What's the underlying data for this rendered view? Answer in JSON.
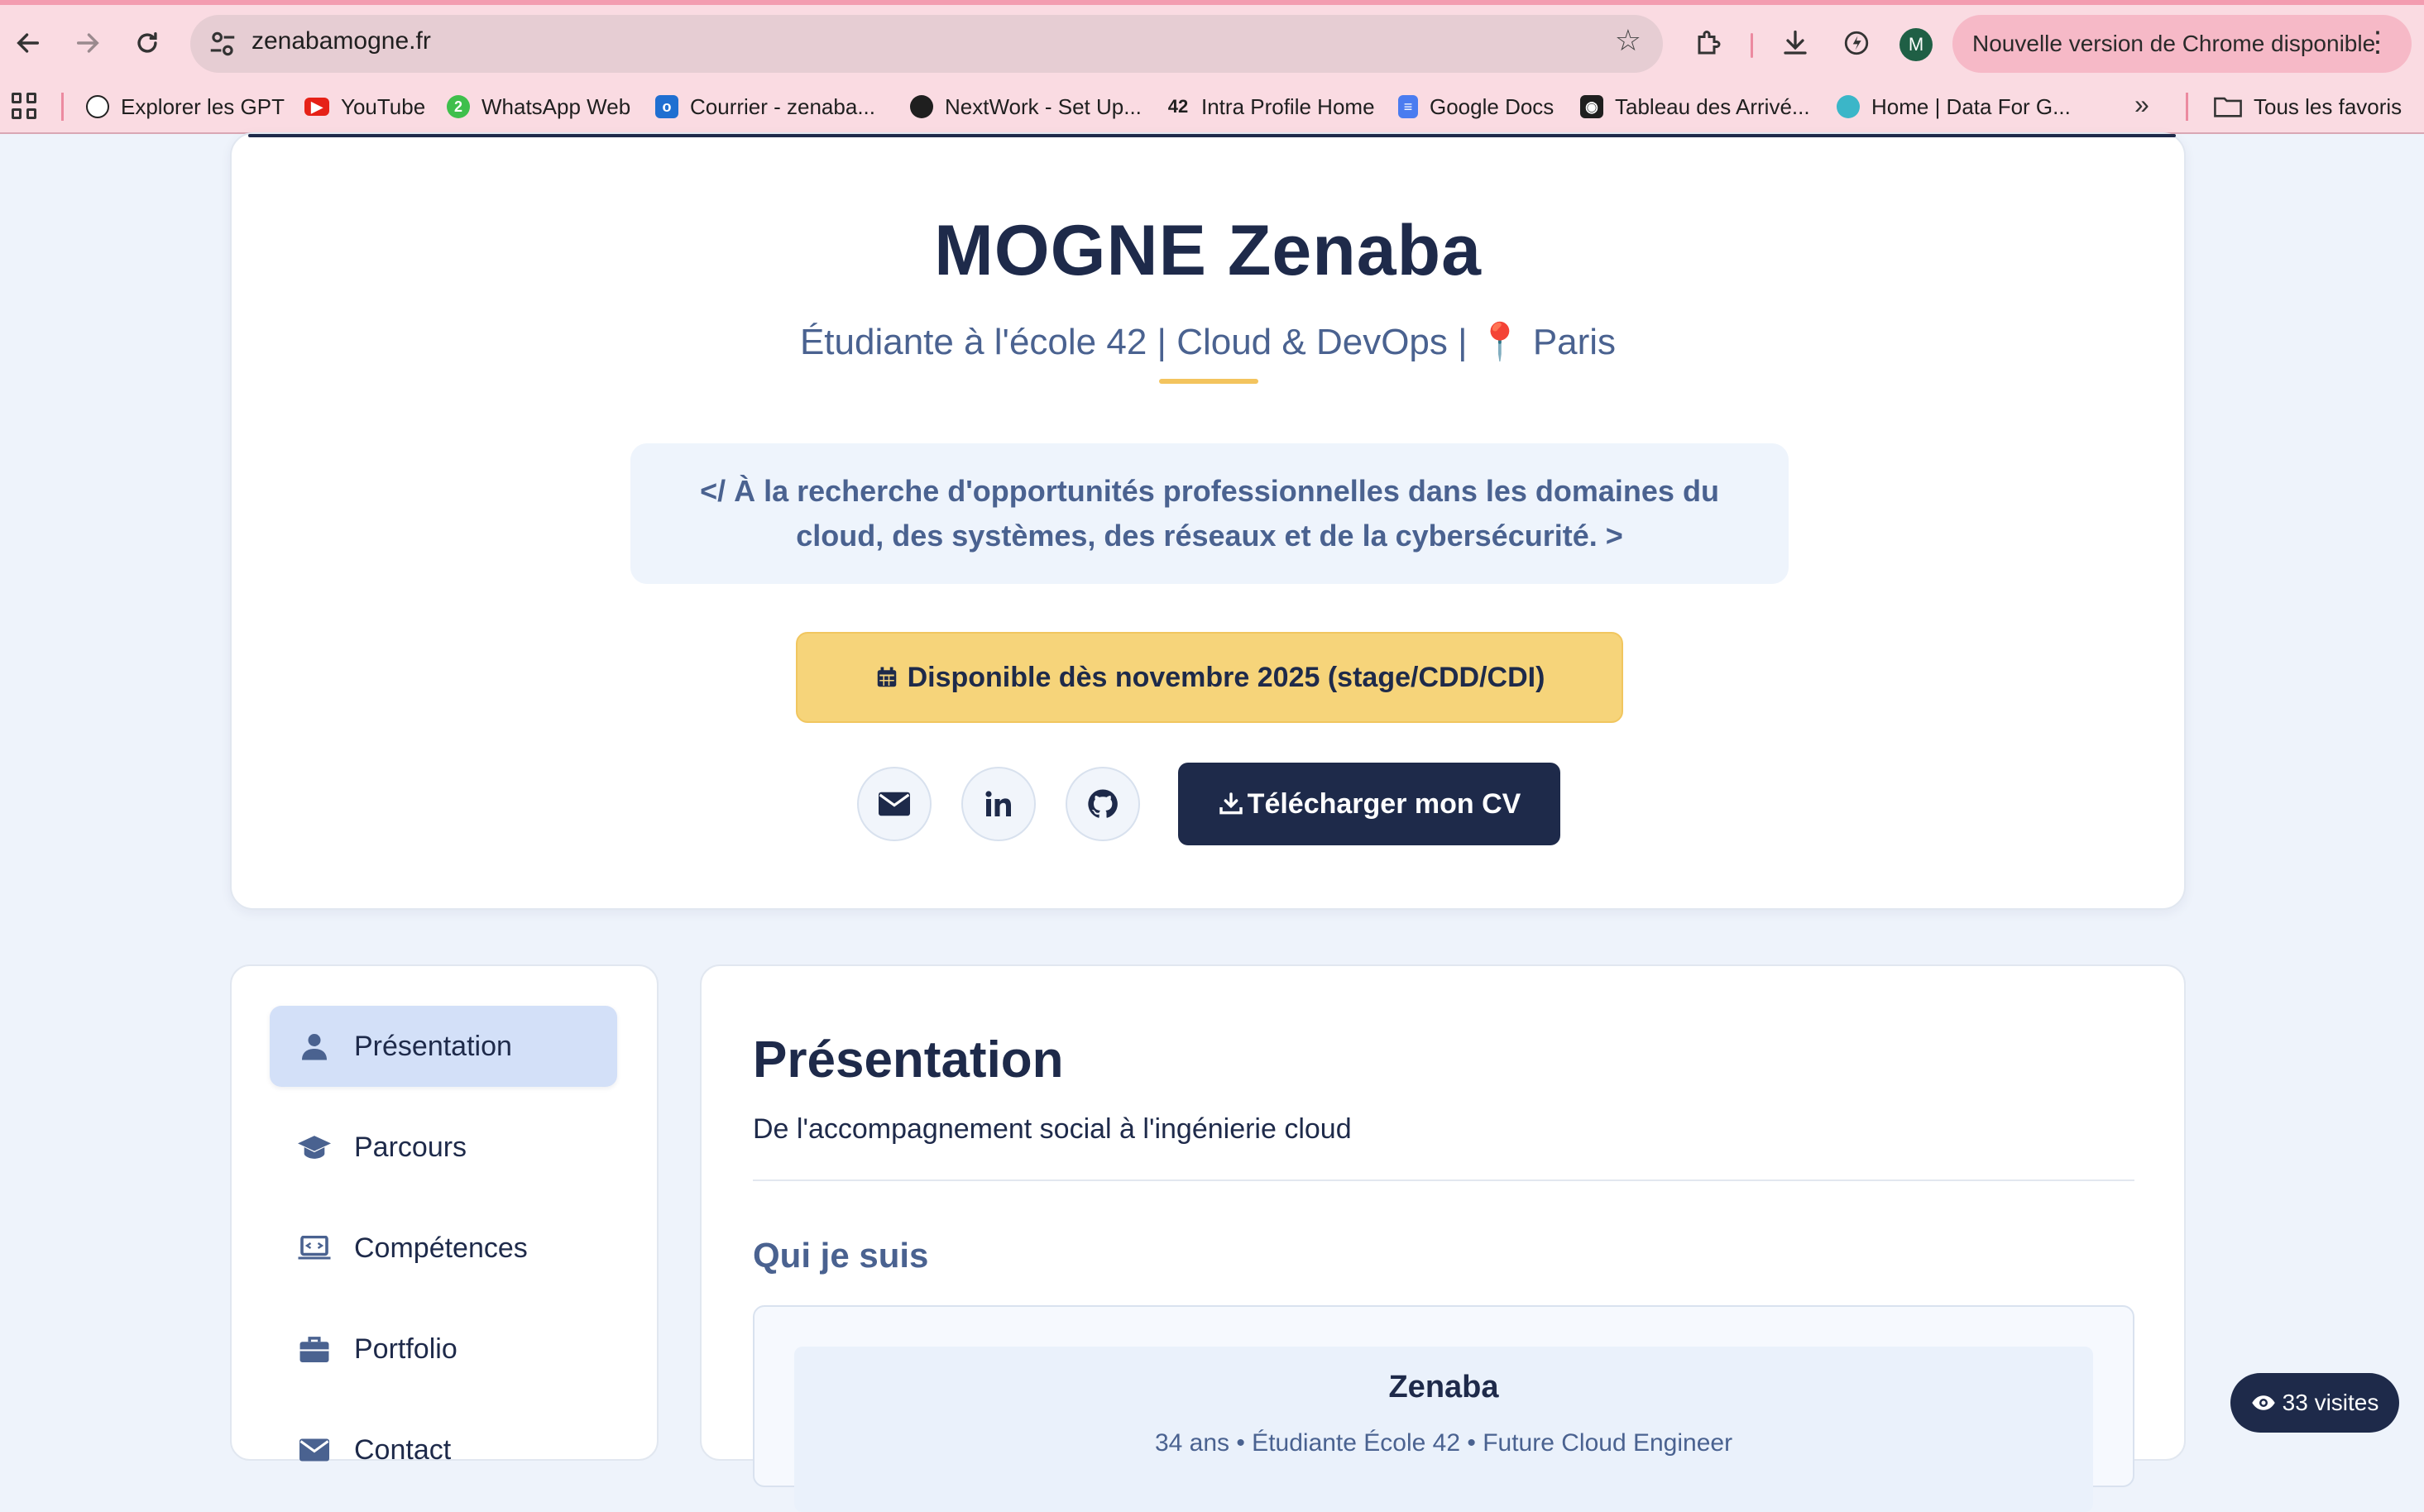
{
  "browser": {
    "url": "zenabamogne.fr",
    "avatar_letter": "M",
    "update_label": "Nouvelle version de Chrome disponible",
    "bookmarks": [
      {
        "label": "Explorer les GPT",
        "icon": "openai-icon",
        "color": "#222222"
      },
      {
        "label": "YouTube",
        "icon": "youtube-icon",
        "color": "#e62117"
      },
      {
        "label": "WhatsApp Web",
        "icon": "whatsapp-icon",
        "color": "#3fbf4c"
      },
      {
        "label": "Courrier - zenaba...",
        "icon": "outlook-icon",
        "color": "#1f6fd1"
      },
      {
        "label": "NextWork - Set Up...",
        "icon": "nextwork-icon",
        "color": "#1f1f1f"
      },
      {
        "label": "Intra Profile Home",
        "icon": "42-icon",
        "color": "#1f1f1f"
      },
      {
        "label": "Google Docs",
        "icon": "google-docs-icon",
        "color": "#4a7cf0"
      },
      {
        "label": "Tableau des Arrivé...",
        "icon": "tableau-icon",
        "color": "#1f1f1f"
      },
      {
        "label": "Home | Data For G...",
        "icon": "dataforgood-icon",
        "color": "#3bb6c8"
      }
    ],
    "all_bookmarks_label": "Tous les favoris"
  },
  "hero": {
    "name": "MOGNE Zenaba",
    "subtitle_left": "Étudiante à l'école 42 | Cloud & DevOps |",
    "subtitle_pin": "📍",
    "subtitle_right": "Paris",
    "quote": "</ À la recherche d'opportunités professionnelles dans les domaines du cloud, des systèmes, des réseaux et de la cybersécurité. >",
    "availability": "Disponible dès novembre 2025 (stage/CDD/CDI)",
    "cv_button": "Télécharger mon CV"
  },
  "sidebar": {
    "items": [
      {
        "label": "Présentation",
        "icon": "user-icon",
        "active": true
      },
      {
        "label": "Parcours",
        "icon": "graduation-cap-icon",
        "active": false
      },
      {
        "label": "Compétences",
        "icon": "laptop-code-icon",
        "active": false
      },
      {
        "label": "Portfolio",
        "icon": "briefcase-icon",
        "active": false
      },
      {
        "label": "Contact",
        "icon": "envelope-icon",
        "active": false
      }
    ]
  },
  "main": {
    "title": "Présentation",
    "lead": "De l'accompagnement social à l'ingénierie cloud",
    "section_title": "Qui je suis",
    "card_name": "Zenaba",
    "card_sub": "34 ans • Étudiante École 42 • Future Cloud Engineer"
  },
  "visits": "33 visites",
  "colors": {
    "navy": "#1e2a4a",
    "accent": "#f6d47a",
    "muted_blue": "#4a6290",
    "chrome_pink": "#fadbe2"
  }
}
